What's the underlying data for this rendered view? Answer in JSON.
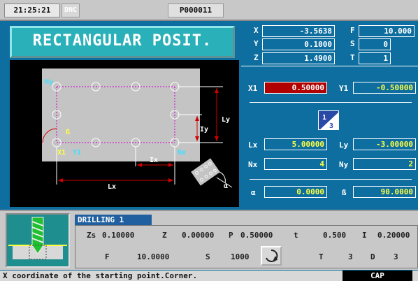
{
  "header": {
    "time": "21:25:21",
    "dnc": "DNC",
    "program": "P000011"
  },
  "cycle_title": "RECTANGULAR POSIT.",
  "coords": {
    "x": {
      "label": "X",
      "value": "-3.5638"
    },
    "y": {
      "label": "Y",
      "value": "0.1000"
    },
    "z": {
      "label": "Z",
      "value": "1.4900"
    },
    "f": {
      "label": "F",
      "value": "10.000"
    },
    "s": {
      "label": "S",
      "value": "0"
    },
    "t": {
      "label": "T",
      "value": "1"
    }
  },
  "params": {
    "x1": {
      "label": "X1",
      "value": "0.50000"
    },
    "y1": {
      "label": "Y1",
      "value": "-0.50000"
    },
    "lx": {
      "label": "Lx",
      "value": "5.00000"
    },
    "ly": {
      "label": "Ly",
      "value": "-3.00000"
    },
    "nx": {
      "label": "Nx",
      "value": "4"
    },
    "ny": {
      "label": "Ny",
      "value": "2"
    },
    "alpha": {
      "label": "α",
      "value": "0.0000"
    },
    "beta": {
      "label": "ß",
      "value": "90.0000"
    }
  },
  "quadrant": {
    "top": "1",
    "bottom": "3"
  },
  "diagram": {
    "ly": "Ly",
    "iy": "Iy",
    "ix": "Ix",
    "lx": "Lx",
    "nx": "Nx",
    "ny": "Ny",
    "x1": "X1",
    "y1": "Y1",
    "beta": "ß",
    "alpha": "α"
  },
  "drilling": {
    "title": "DRILLING 1",
    "row1": [
      {
        "label": "Zs",
        "value": "0.10000"
      },
      {
        "label": "Z",
        "value": "0.00000"
      },
      {
        "label": "P",
        "value": "0.50000"
      },
      {
        "label": "t",
        "value": "0.500"
      },
      {
        "label": "I",
        "value": "0.20000"
      }
    ],
    "row2": [
      {
        "label": "F",
        "value": "10.0000"
      },
      {
        "label": "S",
        "value": "1000"
      },
      {
        "label": "T",
        "value": "3"
      },
      {
        "label": "D",
        "value": "3"
      }
    ]
  },
  "status": {
    "message": "X coordinate of the starting point.Corner.",
    "cap": "CAP"
  },
  "colors": {
    "blue": "#0e6ea0",
    "highlight": "#b00000",
    "param_text": "#ffff40",
    "cyan": "#40e0ff"
  }
}
